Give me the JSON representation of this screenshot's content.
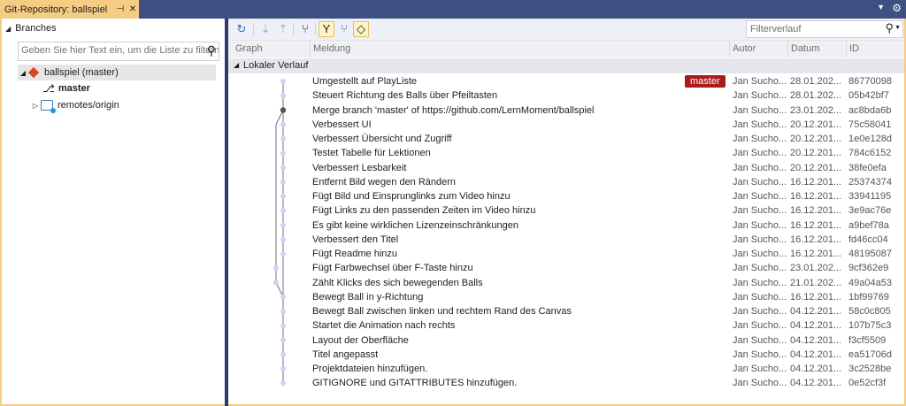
{
  "window": {
    "tab_title": "Git-Repository: ballspiel",
    "pin_icon": "pin-icon",
    "close_icon": "close-icon",
    "menu_icon": "dropdown-icon",
    "settings_icon": "gear-icon"
  },
  "branches": {
    "header": "Branches",
    "search_placeholder": "Geben Sie hier Text ein, um die Liste zu filtern",
    "items": [
      {
        "label": "ballspiel (master)",
        "icon": "repository-icon",
        "expanded": true
      },
      {
        "label": "master",
        "icon": "branch-icon",
        "bold": true
      },
      {
        "label": "remotes/origin",
        "icon": "remote-icon",
        "expanded": false
      }
    ]
  },
  "toolbar": {
    "buttons": [
      "refresh-icon",
      "pull-icon",
      "push-icon",
      "compare-icon",
      "filter-branches-icon",
      "show-remote-icon",
      "show-tags-icon"
    ],
    "filter_placeholder": "Filterverlauf"
  },
  "columns": {
    "graph": "Graph",
    "message": "Meldung",
    "author": "Autor",
    "date": "Datum",
    "id": "ID"
  },
  "history": {
    "group": "Lokaler Verlauf",
    "branch_tag": "master",
    "accent": "#ab1b1b",
    "commits": [
      {
        "message": "Umgestellt auf PlayListe",
        "author": "Jan Sucho...",
        "date": "28.01.202...",
        "id": "86770098"
      },
      {
        "message": "Steuert Richtung des Balls über Pfeiltasten",
        "author": "Jan Sucho...",
        "date": "28.01.202...",
        "id": "05b42bf7"
      },
      {
        "message": "Merge branch 'master' of https://github.com/LernMoment/ballspiel",
        "author": "Jan Sucho...",
        "date": "23.01.202...",
        "id": "ac8bda6b"
      },
      {
        "message": "Verbessert UI",
        "author": "Jan Sucho...",
        "date": "20.12.201...",
        "id": "75c58041"
      },
      {
        "message": "Verbessert Übersicht und Zugriff",
        "author": "Jan Sucho...",
        "date": "20.12.201...",
        "id": "1e0e128d"
      },
      {
        "message": "Testet Tabelle für Lektionen",
        "author": "Jan Sucho...",
        "date": "20.12.201...",
        "id": "784c6152"
      },
      {
        "message": "Verbessert Lesbarkeit",
        "author": "Jan Sucho...",
        "date": "20.12.201...",
        "id": "38fe0efa"
      },
      {
        "message": "Entfernt Bild wegen den Rändern",
        "author": "Jan Sucho...",
        "date": "16.12.201...",
        "id": "25374374"
      },
      {
        "message": "Fügt Bild und Einsprunglinks zum Video hinzu",
        "author": "Jan Sucho...",
        "date": "16.12.201...",
        "id": "33941195"
      },
      {
        "message": "Fügt Links zu den passenden Zeiten im Video hinzu",
        "author": "Jan Sucho...",
        "date": "16.12.201...",
        "id": "3e9ac76e"
      },
      {
        "message": "Es gibt keine wirklichen Lizenzeinschränkungen",
        "author": "Jan Sucho...",
        "date": "16.12.201...",
        "id": "a9bef78a"
      },
      {
        "message": "Verbessert den Titel",
        "author": "Jan Sucho...",
        "date": "16.12.201...",
        "id": "fd46cc04"
      },
      {
        "message": "Fügt Readme hinzu",
        "author": "Jan Sucho...",
        "date": "16.12.201...",
        "id": "48195087"
      },
      {
        "message": "Fügt Farbwechsel über F-Taste hinzu",
        "author": "Jan Sucho...",
        "date": "23.01.202...",
        "id": "9cf362e9"
      },
      {
        "message": "Zählt Klicks des sich bewegenden Balls",
        "author": "Jan Sucho...",
        "date": "21.01.202...",
        "id": "49a04a53"
      },
      {
        "message": "Bewegt Ball in y-Richtung",
        "author": "Jan Sucho...",
        "date": "16.12.201...",
        "id": "1bf99769"
      },
      {
        "message": "Bewegt Ball zwischen linken und rechtem Rand des Canvas",
        "author": "Jan Sucho...",
        "date": "04.12.201...",
        "id": "58c0c805"
      },
      {
        "message": "Startet die Animation nach rechts",
        "author": "Jan Sucho...",
        "date": "04.12.201...",
        "id": "107b75c3"
      },
      {
        "message": "Layout der Oberfläche",
        "author": "Jan Sucho...",
        "date": "04.12.201...",
        "id": "f3cf5509"
      },
      {
        "message": "Titel angepasst",
        "author": "Jan Sucho...",
        "date": "04.12.201...",
        "id": "ea51706d"
      },
      {
        "message": "Projektdateien hinzufügen.",
        "author": "Jan Sucho...",
        "date": "04.12.201...",
        "id": "3c2528be"
      },
      {
        "message": "GITIGNORE und GITATTRIBUTES hinzufügen.",
        "author": "Jan Sucho...",
        "date": "04.12.201...",
        "id": "0e52cf3f"
      }
    ]
  }
}
